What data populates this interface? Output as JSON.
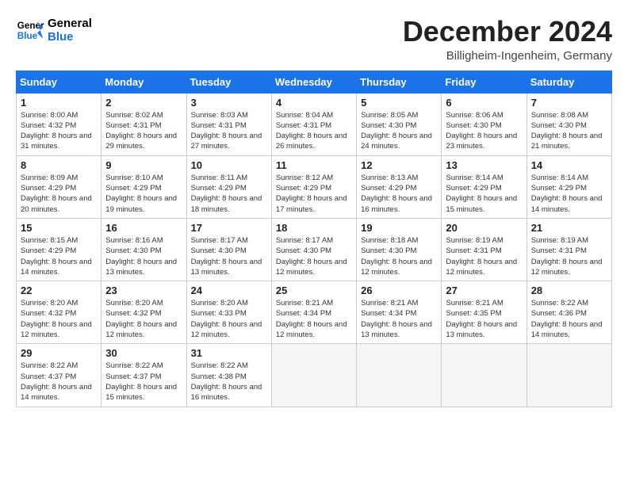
{
  "logo": {
    "line1": "General",
    "line2": "Blue"
  },
  "title": "December 2024",
  "subtitle": "Billigheim-Ingenheim, Germany",
  "days_of_week": [
    "Sunday",
    "Monday",
    "Tuesday",
    "Wednesday",
    "Thursday",
    "Friday",
    "Saturday"
  ],
  "weeks": [
    [
      {
        "day": "1",
        "sunrise": "8:00 AM",
        "sunset": "4:32 PM",
        "daylight": "8 hours and 31 minutes."
      },
      {
        "day": "2",
        "sunrise": "8:02 AM",
        "sunset": "4:31 PM",
        "daylight": "8 hours and 29 minutes."
      },
      {
        "day": "3",
        "sunrise": "8:03 AM",
        "sunset": "4:31 PM",
        "daylight": "8 hours and 27 minutes."
      },
      {
        "day": "4",
        "sunrise": "8:04 AM",
        "sunset": "4:31 PM",
        "daylight": "8 hours and 26 minutes."
      },
      {
        "day": "5",
        "sunrise": "8:05 AM",
        "sunset": "4:30 PM",
        "daylight": "8 hours and 24 minutes."
      },
      {
        "day": "6",
        "sunrise": "8:06 AM",
        "sunset": "4:30 PM",
        "daylight": "8 hours and 23 minutes."
      },
      {
        "day": "7",
        "sunrise": "8:08 AM",
        "sunset": "4:30 PM",
        "daylight": "8 hours and 21 minutes."
      }
    ],
    [
      {
        "day": "8",
        "sunrise": "8:09 AM",
        "sunset": "4:29 PM",
        "daylight": "8 hours and 20 minutes."
      },
      {
        "day": "9",
        "sunrise": "8:10 AM",
        "sunset": "4:29 PM",
        "daylight": "8 hours and 19 minutes."
      },
      {
        "day": "10",
        "sunrise": "8:11 AM",
        "sunset": "4:29 PM",
        "daylight": "8 hours and 18 minutes."
      },
      {
        "day": "11",
        "sunrise": "8:12 AM",
        "sunset": "4:29 PM",
        "daylight": "8 hours and 17 minutes."
      },
      {
        "day": "12",
        "sunrise": "8:13 AM",
        "sunset": "4:29 PM",
        "daylight": "8 hours and 16 minutes."
      },
      {
        "day": "13",
        "sunrise": "8:14 AM",
        "sunset": "4:29 PM",
        "daylight": "8 hours and 15 minutes."
      },
      {
        "day": "14",
        "sunrise": "8:14 AM",
        "sunset": "4:29 PM",
        "daylight": "8 hours and 14 minutes."
      }
    ],
    [
      {
        "day": "15",
        "sunrise": "8:15 AM",
        "sunset": "4:29 PM",
        "daylight": "8 hours and 14 minutes."
      },
      {
        "day": "16",
        "sunrise": "8:16 AM",
        "sunset": "4:30 PM",
        "daylight": "8 hours and 13 minutes."
      },
      {
        "day": "17",
        "sunrise": "8:17 AM",
        "sunset": "4:30 PM",
        "daylight": "8 hours and 13 minutes."
      },
      {
        "day": "18",
        "sunrise": "8:17 AM",
        "sunset": "4:30 PM",
        "daylight": "8 hours and 12 minutes."
      },
      {
        "day": "19",
        "sunrise": "8:18 AM",
        "sunset": "4:30 PM",
        "daylight": "8 hours and 12 minutes."
      },
      {
        "day": "20",
        "sunrise": "8:19 AM",
        "sunset": "4:31 PM",
        "daylight": "8 hours and 12 minutes."
      },
      {
        "day": "21",
        "sunrise": "8:19 AM",
        "sunset": "4:31 PM",
        "daylight": "8 hours and 12 minutes."
      }
    ],
    [
      {
        "day": "22",
        "sunrise": "8:20 AM",
        "sunset": "4:32 PM",
        "daylight": "8 hours and 12 minutes."
      },
      {
        "day": "23",
        "sunrise": "8:20 AM",
        "sunset": "4:32 PM",
        "daylight": "8 hours and 12 minutes."
      },
      {
        "day": "24",
        "sunrise": "8:20 AM",
        "sunset": "4:33 PM",
        "daylight": "8 hours and 12 minutes."
      },
      {
        "day": "25",
        "sunrise": "8:21 AM",
        "sunset": "4:34 PM",
        "daylight": "8 hours and 12 minutes."
      },
      {
        "day": "26",
        "sunrise": "8:21 AM",
        "sunset": "4:34 PM",
        "daylight": "8 hours and 13 minutes."
      },
      {
        "day": "27",
        "sunrise": "8:21 AM",
        "sunset": "4:35 PM",
        "daylight": "8 hours and 13 minutes."
      },
      {
        "day": "28",
        "sunrise": "8:22 AM",
        "sunset": "4:36 PM",
        "daylight": "8 hours and 14 minutes."
      }
    ],
    [
      {
        "day": "29",
        "sunrise": "8:22 AM",
        "sunset": "4:37 PM",
        "daylight": "8 hours and 14 minutes."
      },
      {
        "day": "30",
        "sunrise": "8:22 AM",
        "sunset": "4:37 PM",
        "daylight": "8 hours and 15 minutes."
      },
      {
        "day": "31",
        "sunrise": "8:22 AM",
        "sunset": "4:38 PM",
        "daylight": "8 hours and 16 minutes."
      },
      null,
      null,
      null,
      null
    ]
  ]
}
